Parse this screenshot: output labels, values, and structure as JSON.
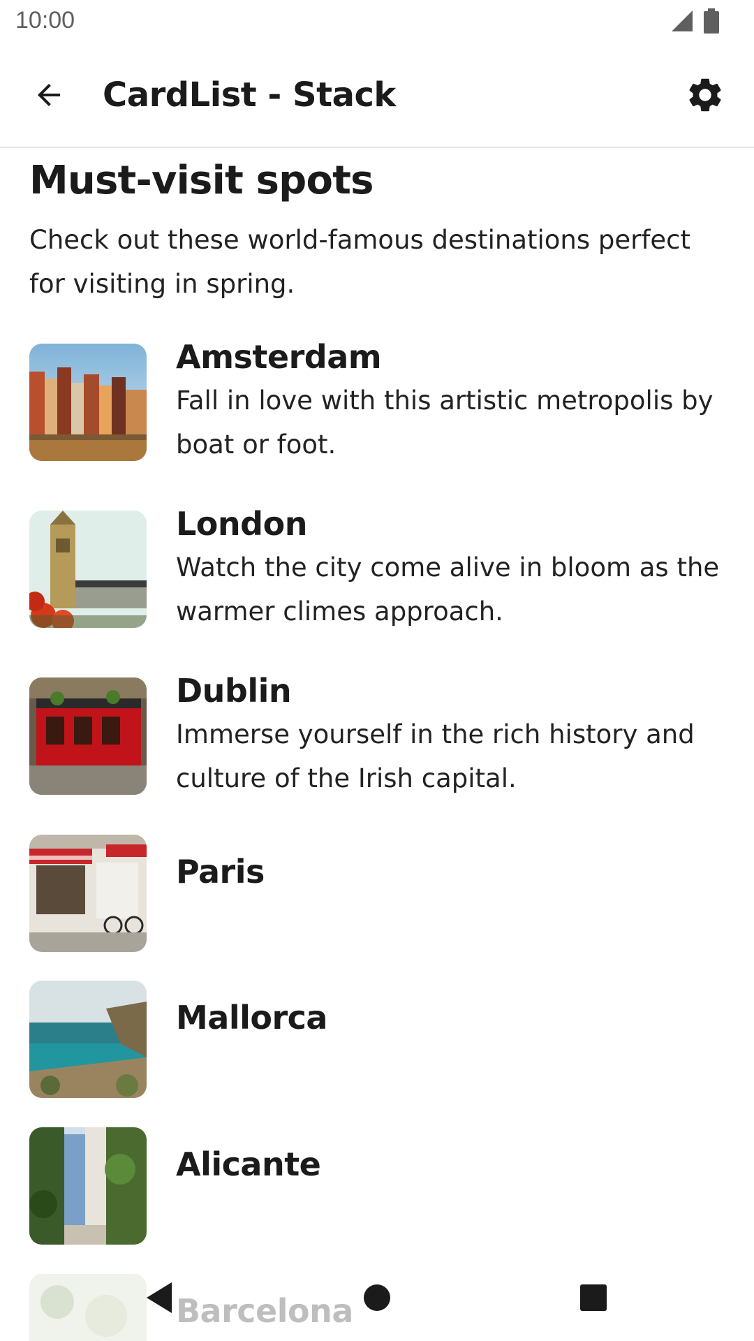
{
  "status": {
    "time": "10:00"
  },
  "app_bar": {
    "title": "CardList - Stack"
  },
  "section": {
    "heading": "Must-visit spots",
    "description": "Check out these world-famous destinations perfect for visiting in spring."
  },
  "cards": [
    {
      "title": "Amsterdam",
      "description": "Fall in love with this artistic metropolis by boat or foot."
    },
    {
      "title": "London",
      "description": "Watch the city come alive in bloom as the warmer climes approach."
    },
    {
      "title": "Dublin",
      "description": "Immerse yourself in the rich history and culture of the Irish capital."
    },
    {
      "title": "Paris",
      "description": ""
    },
    {
      "title": "Mallorca",
      "description": ""
    },
    {
      "title": "Alicante",
      "description": ""
    },
    {
      "title": "Barcelona",
      "description": ""
    }
  ],
  "icons": {
    "back": "arrow-back-icon",
    "settings": "gear-icon",
    "signal": "signal-icon",
    "battery": "battery-icon",
    "nav_back": "triangle-back-icon",
    "nav_home": "circle-home-icon",
    "nav_recents": "square-recents-icon"
  },
  "colors": {
    "text": "#1b1b1b",
    "divider": "#e6e6e6",
    "status_text": "#5f5f5f"
  }
}
